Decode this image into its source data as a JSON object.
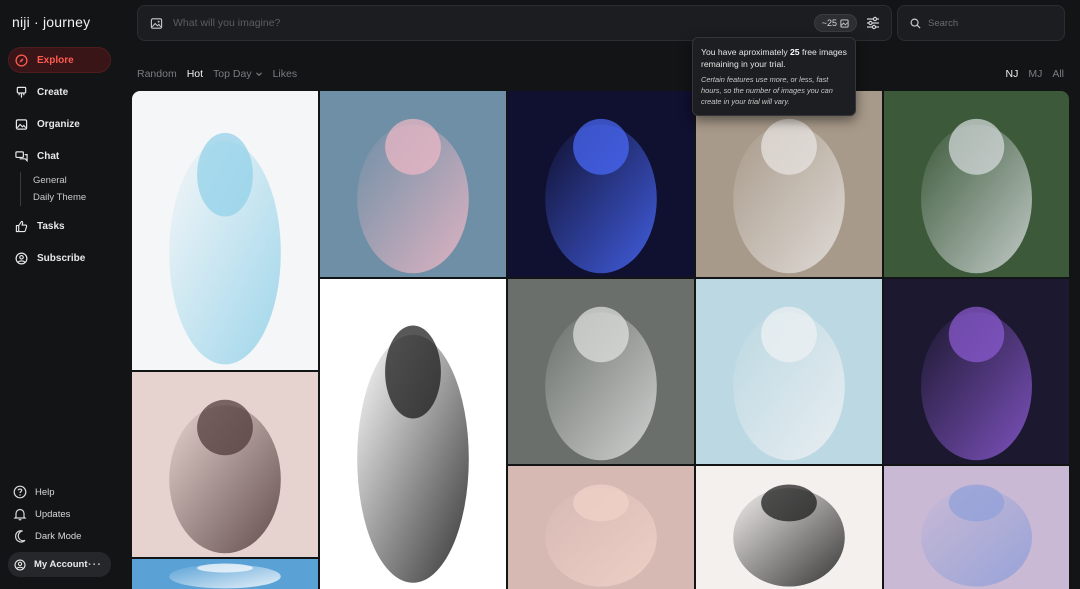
{
  "app": {
    "logo": "niji · journey"
  },
  "sidebar": {
    "items": [
      {
        "label": "Explore",
        "icon": "compass-icon",
        "active": true
      },
      {
        "label": "Create",
        "icon": "brush-icon"
      },
      {
        "label": "Organize",
        "icon": "image-icon"
      },
      {
        "label": "Chat",
        "icon": "chat-icon"
      },
      {
        "label": "Tasks",
        "icon": "thumbs-up-icon"
      },
      {
        "label": "Subscribe",
        "icon": "account-circle-icon"
      }
    ],
    "chat_channels": [
      "General",
      "Daily Theme"
    ],
    "bottom": [
      {
        "label": "Help",
        "icon": "help-icon"
      },
      {
        "label": "Updates",
        "icon": "bell-icon"
      },
      {
        "label": "Dark Mode",
        "icon": "moon-icon"
      }
    ],
    "account_label": "My Account"
  },
  "prompt": {
    "placeholder": "What will you imagine?",
    "credits": "~25"
  },
  "search": {
    "placeholder": "Search"
  },
  "filters": {
    "sort": [
      "Random",
      "Hot",
      "Top Day",
      "Likes"
    ],
    "active_sort": "Hot",
    "models": [
      "NJ",
      "MJ",
      "All"
    ],
    "active_model": "NJ"
  },
  "tooltip": {
    "line_prefix": "You have aproximately ",
    "count": "25",
    "line_suffix": " free images remaining in your trial.",
    "note": "Certain features use more, or less, fast hours, so the number of images you can create in your trial will vary."
  },
  "gallery": {
    "images": [
      {
        "name": "girl-with-blue-serpent-tail",
        "bg": "#f4f6f8",
        "fg": "#8fd0e8"
      },
      {
        "name": "blonde-girl-in-pink-stadium",
        "bg": "#6f8fa6",
        "fg": "#f1b9c6"
      },
      {
        "name": "dark-warrior-blue-lightning",
        "bg": "#101030",
        "fg": "#4b6cff"
      },
      {
        "name": "white-hair-girl-in-uniform",
        "bg": "#a89a8a",
        "fg": "#e9e6e4"
      },
      {
        "name": "white-wolf-in-forest",
        "bg": "#3c5a3a",
        "fg": "#d9dde0"
      },
      {
        "name": "girl-with-hands-on-cheeks",
        "bg": "#e6d3cf",
        "fg": "#4a3534"
      },
      {
        "name": "lineart-girl-black-dress",
        "bg": "#ffffff",
        "fg": "#111111"
      },
      {
        "name": "samurai-with-sword",
        "bg": "#6a6f6c",
        "fg": "#e2e4e2"
      },
      {
        "name": "girl-reaching-in-hallway",
        "bg": "#bcd8e2",
        "fg": "#f0f2f4"
      },
      {
        "name": "dark-bear-with-lightning",
        "bg": "#1c1830",
        "fg": "#8e5cd6"
      },
      {
        "name": "pink-haired-girl-portrait",
        "bg": "#d7b9b4",
        "fg": "#f2d3c9"
      },
      {
        "name": "girl-in-cat-hat",
        "bg": "#f3f0ee",
        "fg": "#151515"
      },
      {
        "name": "dragon-girl-in-blue",
        "bg": "#c9b9d5",
        "fg": "#8e9fd9"
      },
      {
        "name": "blue-sky-clouds",
        "bg": "#5aa2d6",
        "fg": "#ffffff"
      }
    ]
  },
  "colors": {
    "accent": "#ff5a4f",
    "background": "#131416"
  }
}
